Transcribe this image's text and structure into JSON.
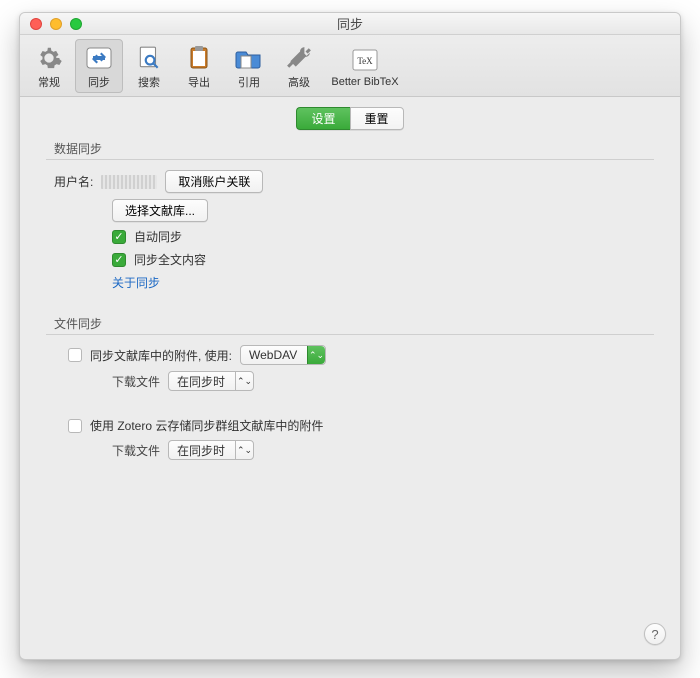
{
  "window": {
    "title": "同步"
  },
  "toolbar": {
    "items": [
      {
        "label": "常规"
      },
      {
        "label": "同步"
      },
      {
        "label": "搜索"
      },
      {
        "label": "导出"
      },
      {
        "label": "引用"
      },
      {
        "label": "高级"
      },
      {
        "label": "Better BibTeX"
      }
    ]
  },
  "tabs": {
    "settings": "设置",
    "reset": "重置"
  },
  "data_sync": {
    "section": "数据同步",
    "username_label": "用户名:",
    "unlink_button": "取消账户关联",
    "choose_library_button": "选择文献库...",
    "auto_sync": "自动同步",
    "fulltext_sync": "同步全文内容",
    "about_link": "关于同步"
  },
  "file_sync": {
    "section": "文件同步",
    "myfiles_label": "同步文献库中的附件, 使用:",
    "method_selected": "WebDAV",
    "download_label": "下载文件",
    "download_selected": "在同步时",
    "groups_label": "使用 Zotero 云存储同步群组文献库中的附件",
    "download2_label": "下载文件",
    "download2_selected": "在同步时"
  },
  "help": "?"
}
